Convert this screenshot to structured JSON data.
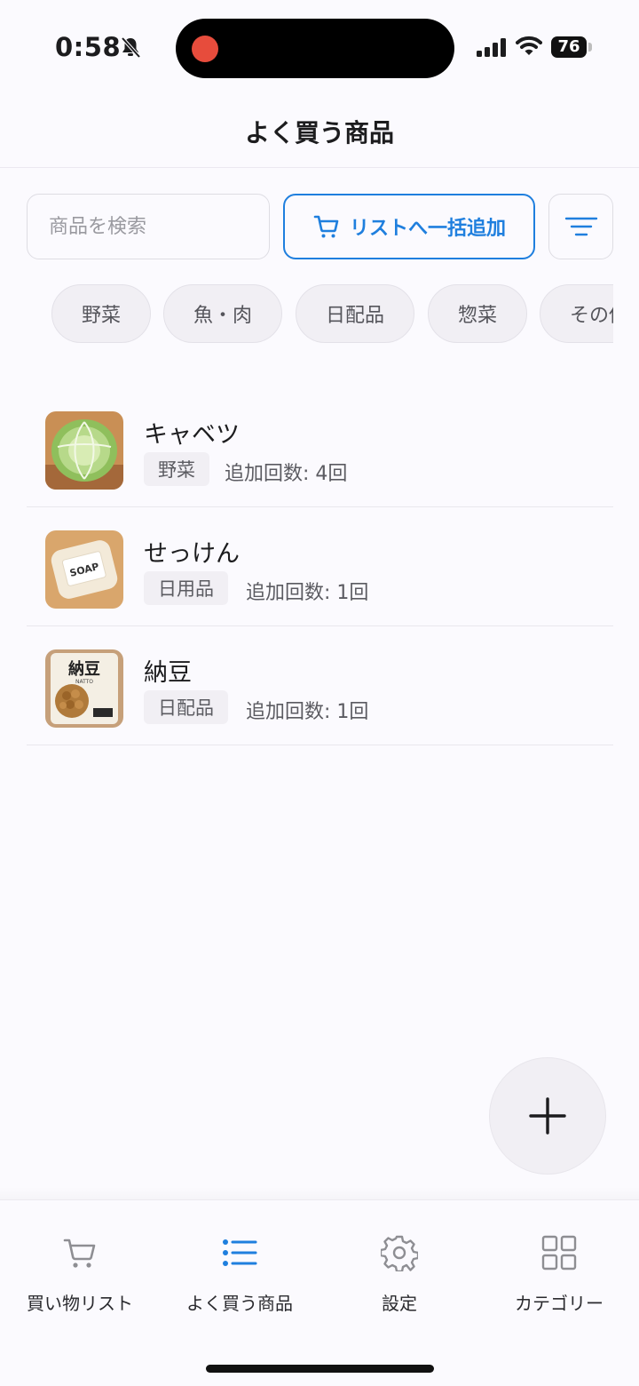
{
  "status_bar": {
    "time": "0:58",
    "battery": "76"
  },
  "header": {
    "title": "よく買う商品"
  },
  "toolbar": {
    "search_placeholder": "商品を検索",
    "bulk_add_label": "リストへ一括追加"
  },
  "categories": [
    "野菜",
    "魚・肉",
    "日配品",
    "惣菜",
    "その他"
  ],
  "items": [
    {
      "name": "キャベツ",
      "category": "野菜",
      "count": "追加回数: 4回"
    },
    {
      "name": "せっけん",
      "category": "日用品",
      "count": "追加回数: 1回"
    },
    {
      "name": "納豆",
      "category": "日配品",
      "count": "追加回数: 1回"
    }
  ],
  "tabs": [
    {
      "label": "買い物リスト",
      "icon": "cart-icon",
      "active": false
    },
    {
      "label": "よく買う商品",
      "icon": "list-icon",
      "active": true
    },
    {
      "label": "設定",
      "icon": "gear-icon",
      "active": false
    },
    {
      "label": "カテゴリー",
      "icon": "grid-icon",
      "active": false
    }
  ],
  "colors": {
    "accent": "#1f7fde",
    "background": "#fbfafe",
    "chip_bg": "#f1eff4"
  }
}
